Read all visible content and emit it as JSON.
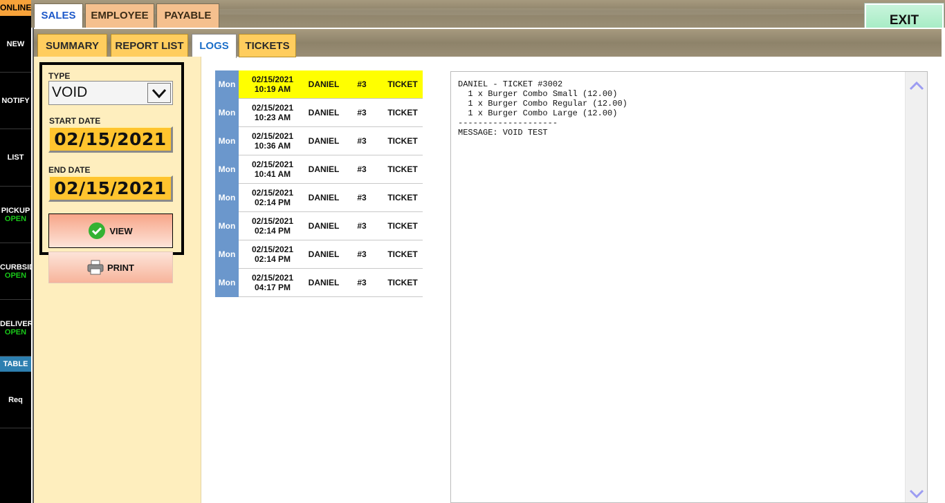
{
  "sidebar": {
    "status": "ONLINE",
    "items": [
      {
        "label": "NEW",
        "sub": ""
      },
      {
        "label": "NOTIFY",
        "sub": ""
      },
      {
        "label": "LIST",
        "sub": ""
      },
      {
        "label": "PICKUP",
        "sub": "OPEN"
      },
      {
        "label": "CURBSID",
        "sub": "OPEN"
      },
      {
        "label": "DELIVERY",
        "sub": "OPEN"
      }
    ],
    "table_label": "TABLE",
    "req_label": "Req"
  },
  "top_tabs": [
    "SALES",
    "EMPLOYEE",
    "PAYABLE"
  ],
  "exit_label": "EXIT",
  "sub_tabs": [
    "SUMMARY",
    "REPORT LIST",
    "LOGS",
    "TICKETS"
  ],
  "filters": {
    "type_label": "TYPE",
    "type_value": "VOID",
    "start_label": "START DATE",
    "start_value": "02/15/2021",
    "end_label": "END DATE",
    "end_value": "02/15/2021",
    "view_label": "VIEW",
    "print_label": "PRINT"
  },
  "logs": [
    {
      "day": "Mon",
      "date": "02/15/2021",
      "time": "10:19 AM",
      "user": "DANIEL",
      "num": "#3",
      "type": "TICKET",
      "selected": true
    },
    {
      "day": "Mon",
      "date": "02/15/2021",
      "time": "10:23 AM",
      "user": "DANIEL",
      "num": "#3",
      "type": "TICKET"
    },
    {
      "day": "Mon",
      "date": "02/15/2021",
      "time": "10:36 AM",
      "user": "DANIEL",
      "num": "#3",
      "type": "TICKET"
    },
    {
      "day": "Mon",
      "date": "02/15/2021",
      "time": "10:41 AM",
      "user": "DANIEL",
      "num": "#3",
      "type": "TICKET"
    },
    {
      "day": "Mon",
      "date": "02/15/2021",
      "time": "02:14 PM",
      "user": "DANIEL",
      "num": "#3",
      "type": "TICKET"
    },
    {
      "day": "Mon",
      "date": "02/15/2021",
      "time": "02:14 PM",
      "user": "DANIEL",
      "num": "#3",
      "type": "TICKET"
    },
    {
      "day": "Mon",
      "date": "02/15/2021",
      "time": "02:14 PM",
      "user": "DANIEL",
      "num": "#3",
      "type": "TICKET"
    },
    {
      "day": "Mon",
      "date": "02/15/2021",
      "time": "04:17 PM",
      "user": "DANIEL",
      "num": "#3",
      "type": "TICKET"
    }
  ],
  "detail_lines": [
    "DANIEL - TICKET #3002",
    "  1 x Burger Combo Small (12.00)",
    "  1 x Burger Combo Regular (12.00)",
    "  1 x Burger Combo Large (12.00)",
    "--------------------",
    "MESSAGE: VOID TEST"
  ],
  "colors": {
    "accent_yellow": "#ffc42e",
    "selected_row": "#ffff00",
    "day_cell": "#6b97cc",
    "sidebar_open": "#19c819",
    "exit_green": "#9ce8bd"
  }
}
